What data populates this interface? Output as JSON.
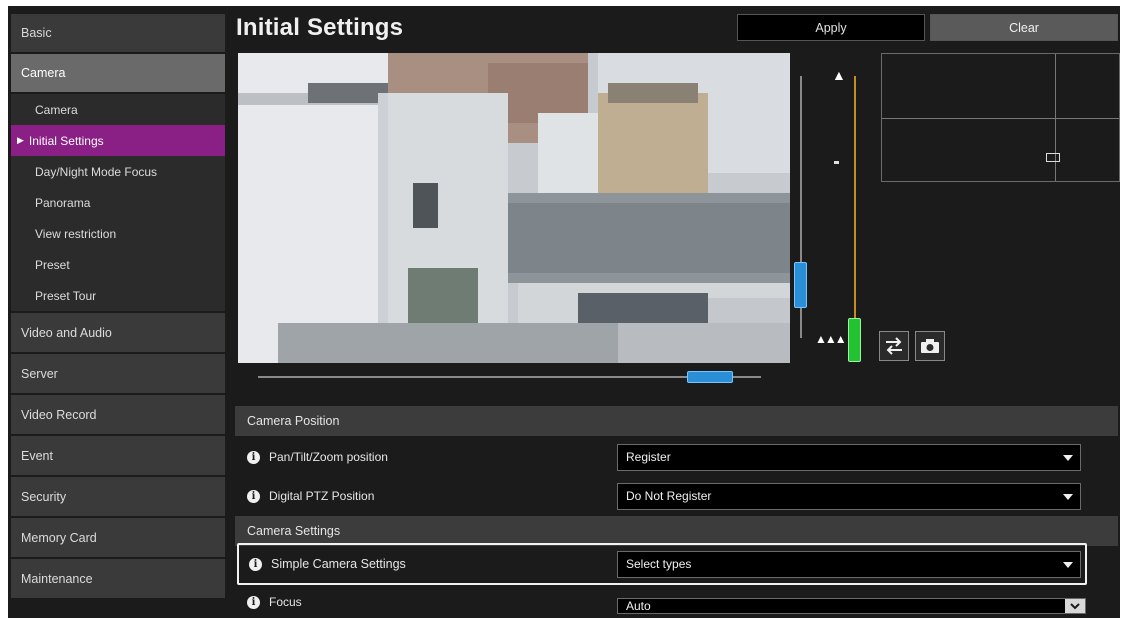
{
  "sidebar": {
    "top": "Basic",
    "camera_group": "Camera",
    "sub_items": [
      "Camera",
      "Initial Settings",
      "Day/Night Mode Focus",
      "Panorama",
      "View restriction",
      "Preset",
      "Preset Tour"
    ],
    "items": [
      "Video and Audio",
      "Server",
      "Video Record",
      "Event",
      "Security",
      "Memory Card",
      "Maintenance"
    ]
  },
  "header": {
    "title": "Initial Settings",
    "apply_label": "Apply",
    "clear_label": "Clear"
  },
  "sections": {
    "camera_position": "Camera Position",
    "camera_settings": "Camera Settings"
  },
  "settings": {
    "ptz_label": "Pan/Tilt/Zoom position",
    "ptz_value": "Register",
    "digital_ptz_label": "Digital PTZ Position",
    "digital_ptz_value": "Do Not Register",
    "simple_label": "Simple Camera Settings",
    "simple_value": "Select types",
    "focus_label": "Focus",
    "focus_value": "Auto"
  },
  "colors": {
    "selected_nav": "#8a1f86",
    "tilt_thumb": "#2a8fd6",
    "zoom_thumb": "#22c232",
    "zoom_track": "#c98b1c"
  }
}
